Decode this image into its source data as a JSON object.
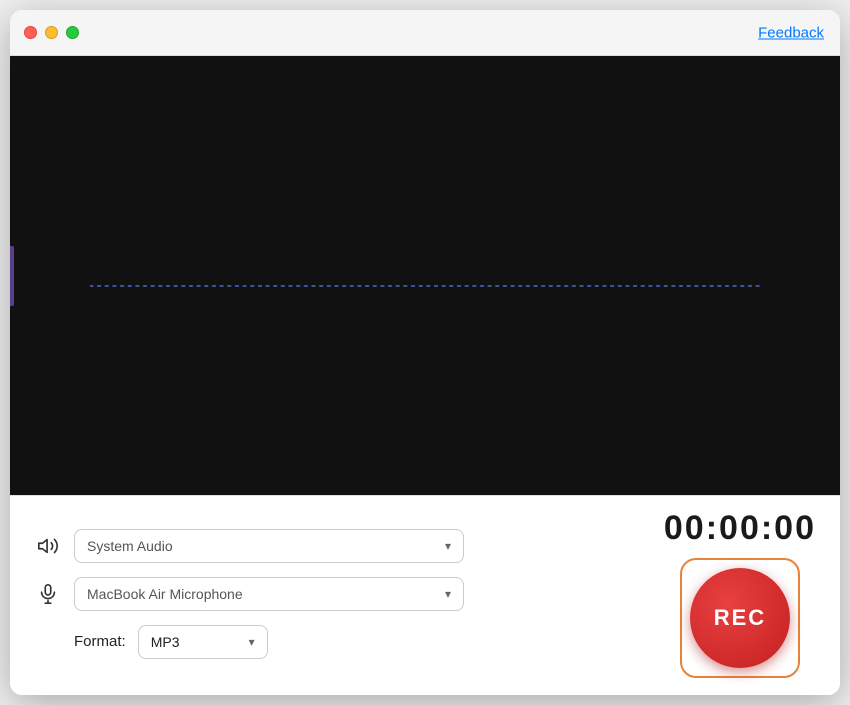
{
  "titlebar": {
    "feedback_label": "Feedback"
  },
  "display": {
    "waveform_color": "#4a6cc8"
  },
  "controls": {
    "audio_icon_title": "speaker-icon",
    "mic_icon_title": "microphone-icon",
    "system_audio_placeholder": "System Audio",
    "microphone_label": "MacBook Air Microphone",
    "format_label": "Format:",
    "format_value": "MP3",
    "timer_value": "00:00:00",
    "rec_label": "REC",
    "audio_dropdown_arrow": "▾",
    "mic_dropdown_arrow": "▾",
    "format_dropdown_arrow": "▾"
  }
}
